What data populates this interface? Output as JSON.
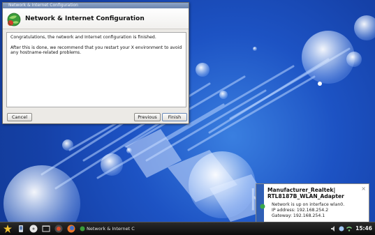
{
  "window": {
    "title": "Network & Internet Configuration",
    "heading": "Network & Internet Configuration",
    "message_line1": "Congratulations, the network and Internet configuration is finished.",
    "message_line2": "After this is done, we recommend that you restart your X environment to avoid any hostname-related problems.",
    "buttons": {
      "cancel": "Cancel",
      "previous": "Previous",
      "finish": "Finish"
    }
  },
  "notification": {
    "title": "Manufacturer_Realtek| RTL8187B_WLAN_Adapter",
    "line1": "Network is up on interface wlan0.",
    "line2": "IP address: 192.168.254.2",
    "line3": "Gateway: 192.168.254.1",
    "close": "×"
  },
  "taskbar": {
    "task_label": "Network & Internet C",
    "clock": "15:46",
    "icons": [
      "mandriva-star-icon",
      "mobile-device-icon",
      "disk-icon",
      "terminal-icon",
      "settings-icon",
      "firefox-icon"
    ],
    "tray": [
      "volume-icon",
      "network-icon",
      "wifi-icon"
    ]
  },
  "colors": {
    "wallpaper": "#1d53c4",
    "taskbar": "#121212",
    "notification_stripe": "#2f5fb5"
  }
}
